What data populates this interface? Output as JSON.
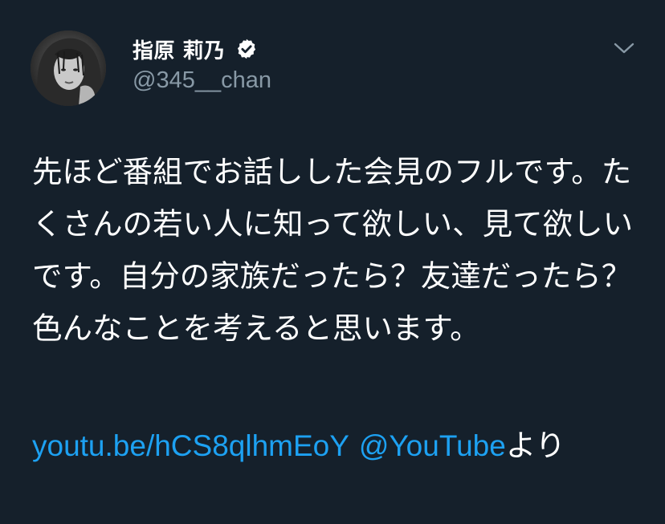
{
  "tweet": {
    "author": {
      "display_name": "指原 莉乃",
      "handle": "@345__chan",
      "verified": true,
      "avatar": "avatar-portrait"
    },
    "menu_icon": "chevron-down-icon",
    "text": "先ほど番組でお話しした会見のフルです。たくさんの若い人に知って欲しい、見て欲しいです。自分の家族だったら？友達だったら？色んなことを考えると思います。",
    "link_url": "youtu.be/hCS8qlhmEoY",
    "link_mention": "@YouTube",
    "link_suffix": "より"
  },
  "colors": {
    "background": "#15202b",
    "text": "#ffffff",
    "secondary": "#8899a6",
    "link": "#1da1f2"
  }
}
